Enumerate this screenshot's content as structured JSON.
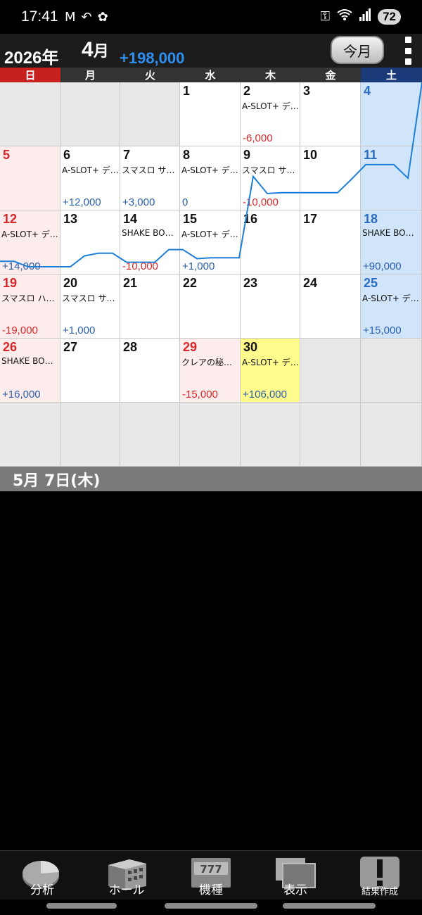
{
  "status_bar": {
    "time": "17:41",
    "left_icons": [
      "gmail-icon",
      "reply-icon",
      "paw-icon"
    ],
    "right_icons": [
      "key-icon",
      "wifi-icon",
      "signal-icon"
    ],
    "battery": "72"
  },
  "header": {
    "year": "2026年",
    "month_num": "4",
    "month_suffix": "月",
    "total": "+198,000",
    "today_button": "今月",
    "menu_icon": "more-vert-icon"
  },
  "weekdays": [
    "日",
    "月",
    "火",
    "水",
    "木",
    "金",
    "土"
  ],
  "calendar": {
    "rows": [
      [
        {
          "day": "",
          "type": "empty"
        },
        {
          "day": "",
          "type": "empty"
        },
        {
          "day": "",
          "type": "empty"
        },
        {
          "day": "1",
          "type": "normal"
        },
        {
          "day": "2",
          "type": "normal",
          "machine": "A-SLOT+ デ…",
          "amount": "-6,000",
          "sign": "neg"
        },
        {
          "day": "3",
          "type": "normal"
        },
        {
          "day": "4",
          "type": "sat"
        }
      ],
      [
        {
          "day": "5",
          "type": "sun"
        },
        {
          "day": "6",
          "type": "normal",
          "machine": "A-SLOT+ デ…",
          "amount": "+12,000",
          "sign": "pos"
        },
        {
          "day": "7",
          "type": "normal",
          "machine": "スマスロ サ…",
          "amount": "+3,000",
          "sign": "pos"
        },
        {
          "day": "8",
          "type": "normal",
          "machine": "A-SLOT+ デ…",
          "amount": "0",
          "sign": "zero"
        },
        {
          "day": "9",
          "type": "normal",
          "machine": "スマスロ サ…",
          "amount": "-10,000",
          "sign": "neg"
        },
        {
          "day": "10",
          "type": "normal"
        },
        {
          "day": "11",
          "type": "sat"
        }
      ],
      [
        {
          "day": "12",
          "type": "sun",
          "machine": "A-SLOT+ デ…",
          "amount": "+14,000",
          "sign": "pos"
        },
        {
          "day": "13",
          "type": "normal"
        },
        {
          "day": "14",
          "type": "normal",
          "machine": "SHAKE BON…",
          "amount": "-10,000",
          "sign": "neg"
        },
        {
          "day": "15",
          "type": "normal",
          "machine": "A-SLOT+ デ…",
          "amount": "+1,000",
          "sign": "pos"
        },
        {
          "day": "16",
          "type": "normal"
        },
        {
          "day": "17",
          "type": "normal"
        },
        {
          "day": "18",
          "type": "sat",
          "machine": "SHAKE BON…",
          "amount": "+90,000",
          "sign": "pos"
        }
      ],
      [
        {
          "day": "19",
          "type": "sun",
          "machine": "スマスロ ハ…",
          "amount": "-19,000",
          "sign": "neg"
        },
        {
          "day": "20",
          "type": "normal",
          "machine": "スマスロ サ…",
          "amount": "+1,000",
          "sign": "pos"
        },
        {
          "day": "21",
          "type": "normal"
        },
        {
          "day": "22",
          "type": "normal"
        },
        {
          "day": "23",
          "type": "normal"
        },
        {
          "day": "24",
          "type": "normal"
        },
        {
          "day": "25",
          "type": "sat",
          "machine": "A-SLOT+ デ…",
          "amount": "+15,000",
          "sign": "pos"
        }
      ],
      [
        {
          "day": "26",
          "type": "sun",
          "machine": "SHAKE BON…",
          "amount": "+16,000",
          "sign": "pos"
        },
        {
          "day": "27",
          "type": "normal"
        },
        {
          "day": "28",
          "type": "normal"
        },
        {
          "day": "29",
          "type": "sun-holiday",
          "machine": "クレアの秘…",
          "amount": "-15,000",
          "sign": "neg"
        },
        {
          "day": "30",
          "type": "today",
          "machine": "A-SLOT+ デ…",
          "amount": "+106,000",
          "sign": "pos"
        },
        {
          "day": "",
          "type": "empty"
        },
        {
          "day": "",
          "type": "empty"
        }
      ],
      [
        {
          "day": "",
          "type": "empty"
        },
        {
          "day": "",
          "type": "empty"
        },
        {
          "day": "",
          "type": "empty"
        },
        {
          "day": "",
          "type": "empty"
        },
        {
          "day": "",
          "type": "empty"
        },
        {
          "day": "",
          "type": "empty"
        },
        {
          "day": "",
          "type": "empty"
        }
      ]
    ]
  },
  "trend_line": {
    "color": "#1e7fd8",
    "cumulative": [
      0,
      0,
      -6000,
      -6000,
      -6000,
      -6000,
      6000,
      9000,
      9000,
      -1000,
      -1000,
      -1000,
      13000,
      13000,
      3000,
      4000,
      4000,
      4000,
      94000,
      75000,
      76000,
      76000,
      76000,
      76000,
      76000,
      91000,
      107000,
      107000,
      107000,
      92000,
      198000
    ]
  },
  "selected_date": "5月  7日(木)",
  "bottom_nav": [
    {
      "label": "分析",
      "icon": "pie-chart-icon"
    },
    {
      "label": "ホール",
      "icon": "building-icon"
    },
    {
      "label": "機種",
      "icon": "slot-machine-icon"
    },
    {
      "label": "表示",
      "icon": "display-icon"
    },
    {
      "label": "結果作成",
      "icon": "exclamation-icon"
    }
  ]
}
